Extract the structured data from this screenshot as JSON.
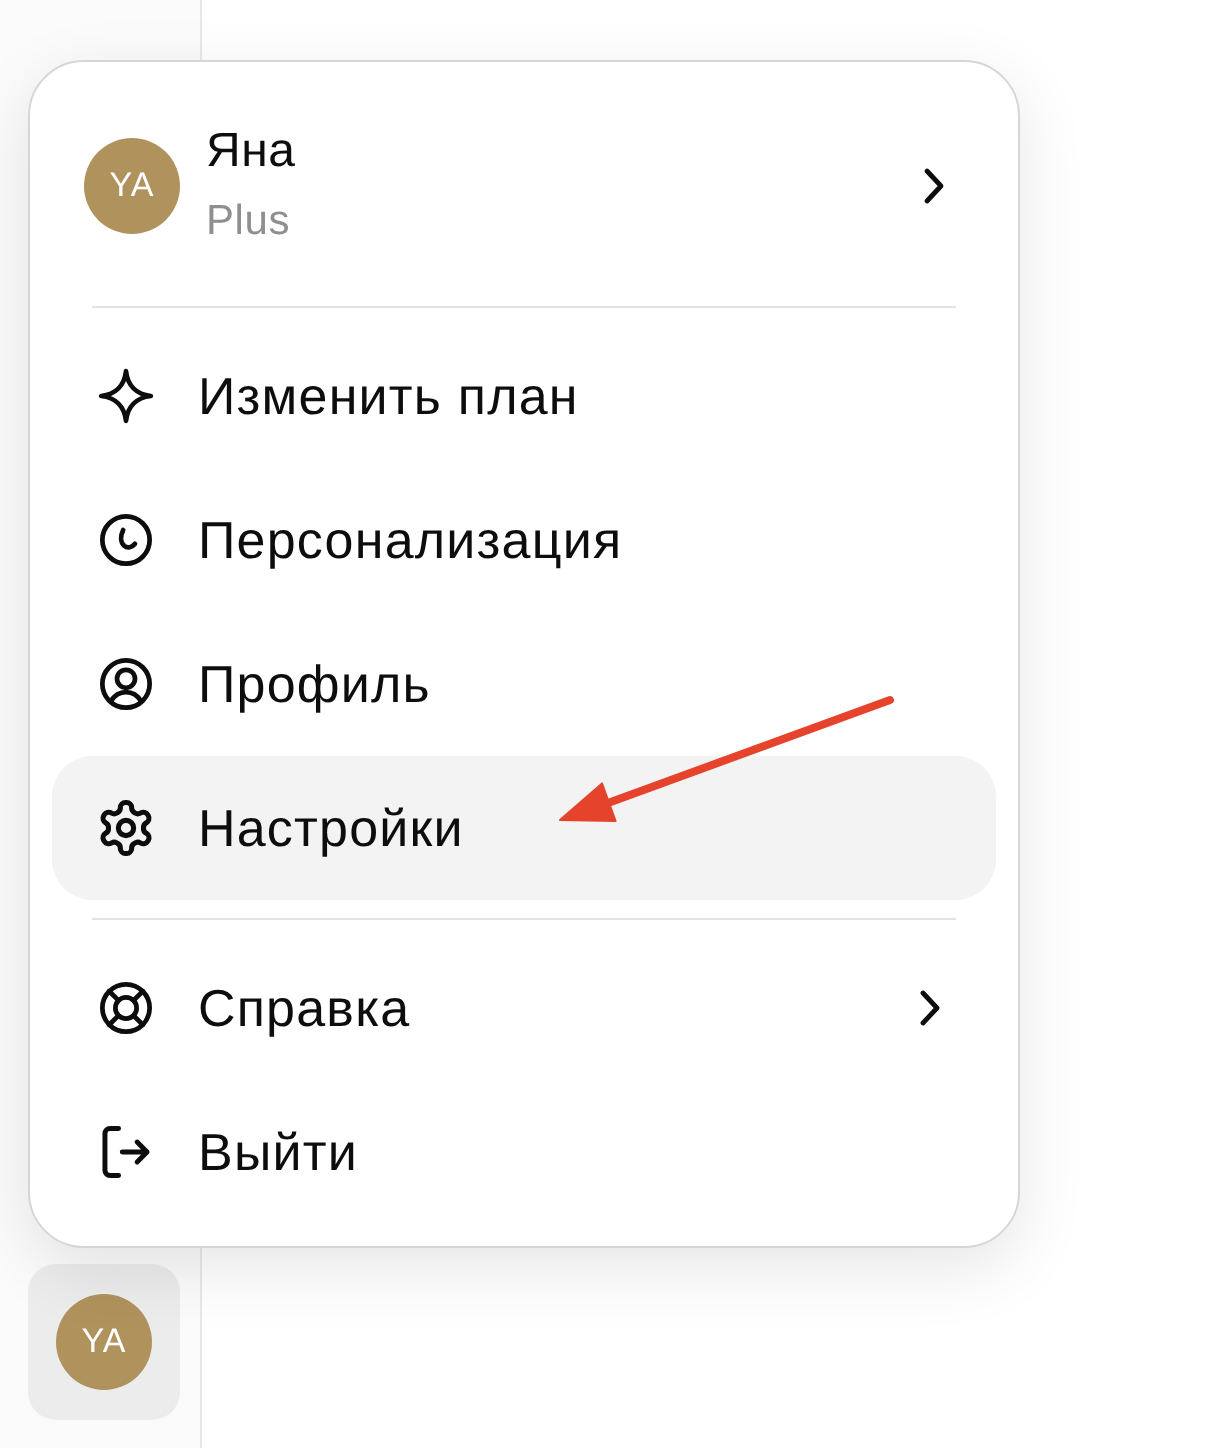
{
  "user_header": {
    "avatar_initials": "YA",
    "name": "Яна",
    "plan": "Plus",
    "has_submenu": true
  },
  "menu_sections": [
    {
      "items": [
        {
          "kind": "upgrade",
          "label": "Изменить план",
          "selected": false,
          "has_submenu": false
        },
        {
          "kind": "personalize",
          "label": "Персонализация",
          "selected": false,
          "has_submenu": false
        },
        {
          "kind": "profile",
          "label": "Профиль",
          "selected": false,
          "has_submenu": false
        },
        {
          "kind": "settings",
          "label": "Настройки",
          "selected": true,
          "has_submenu": false
        }
      ]
    },
    {
      "items": [
        {
          "kind": "help",
          "label": "Справка",
          "selected": false,
          "has_submenu": true
        },
        {
          "kind": "logout",
          "label": "Выйти",
          "selected": false,
          "has_submenu": false
        }
      ]
    }
  ],
  "sidebar": {
    "account_button": {
      "avatar_initials": "YA"
    }
  }
}
